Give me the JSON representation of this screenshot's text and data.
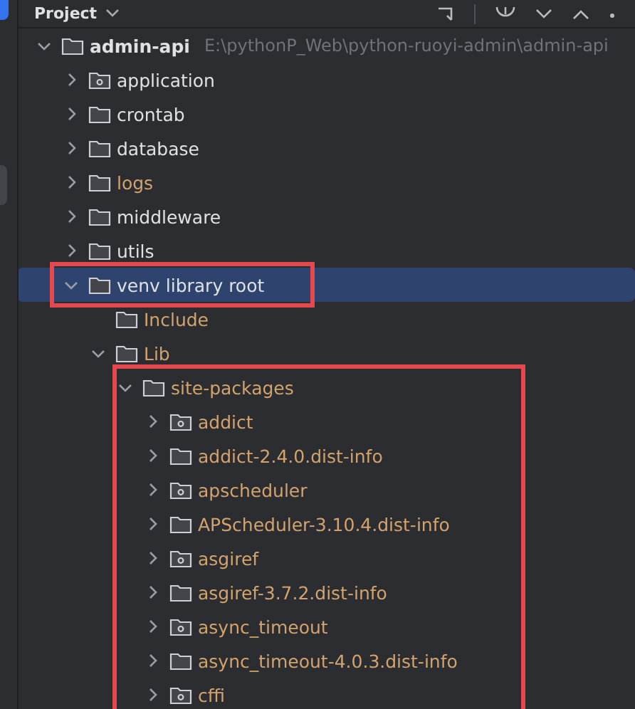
{
  "panel": {
    "title": "Project"
  },
  "tree": [
    {
      "name": "admin-api",
      "path": "E:\\pythonP_Web\\python-ruoyi-admin\\admin-api",
      "kind": "folder",
      "expanded": true,
      "selected": false,
      "excluded": false,
      "children": [
        {
          "name": "application",
          "kind": "package",
          "expanded": false,
          "selected": false,
          "excluded": false
        },
        {
          "name": "crontab",
          "kind": "folder",
          "expanded": false,
          "selected": false,
          "excluded": false
        },
        {
          "name": "database",
          "kind": "folder",
          "expanded": false,
          "selected": false,
          "excluded": false
        },
        {
          "name": "logs",
          "kind": "folder",
          "expanded": false,
          "selected": false,
          "excluded": true
        },
        {
          "name": "middleware",
          "kind": "folder",
          "expanded": false,
          "selected": false,
          "excluded": false
        },
        {
          "name": "utils",
          "kind": "folder",
          "expanded": false,
          "selected": false,
          "excluded": false
        },
        {
          "name": "venv  library root",
          "kind": "folder",
          "expanded": true,
          "selected": true,
          "excluded": false,
          "children": [
            {
              "name": "Include",
              "kind": "folder",
              "selected": false,
              "excluded": true
            },
            {
              "name": "Lib",
              "kind": "folder",
              "expanded": true,
              "selected": false,
              "excluded": true,
              "children": [
                {
                  "name": "site-packages",
                  "kind": "folder",
                  "expanded": true,
                  "selected": false,
                  "excluded": true,
                  "children": [
                    {
                      "name": "addict",
                      "kind": "package",
                      "expanded": false,
                      "selected": false,
                      "excluded": true
                    },
                    {
                      "name": "addict-2.4.0.dist-info",
                      "kind": "folder",
                      "expanded": false,
                      "selected": false,
                      "excluded": true
                    },
                    {
                      "name": "apscheduler",
                      "kind": "package",
                      "expanded": false,
                      "selected": false,
                      "excluded": true
                    },
                    {
                      "name": "APScheduler-3.10.4.dist-info",
                      "kind": "folder",
                      "expanded": false,
                      "selected": false,
                      "excluded": true
                    },
                    {
                      "name": "asgiref",
                      "kind": "package",
                      "expanded": false,
                      "selected": false,
                      "excluded": true
                    },
                    {
                      "name": "asgiref-3.7.2.dist-info",
                      "kind": "folder",
                      "expanded": false,
                      "selected": false,
                      "excluded": true
                    },
                    {
                      "name": "async_timeout",
                      "kind": "package",
                      "expanded": false,
                      "selected": false,
                      "excluded": true
                    },
                    {
                      "name": "async_timeout-4.0.3.dist-info",
                      "kind": "folder",
                      "expanded": false,
                      "selected": false,
                      "excluded": true
                    },
                    {
                      "name": "cffi",
                      "kind": "package",
                      "expanded": false,
                      "selected": false,
                      "excluded": true
                    }
                  ]
                }
              ]
            }
          ]
        }
      ]
    }
  ]
}
